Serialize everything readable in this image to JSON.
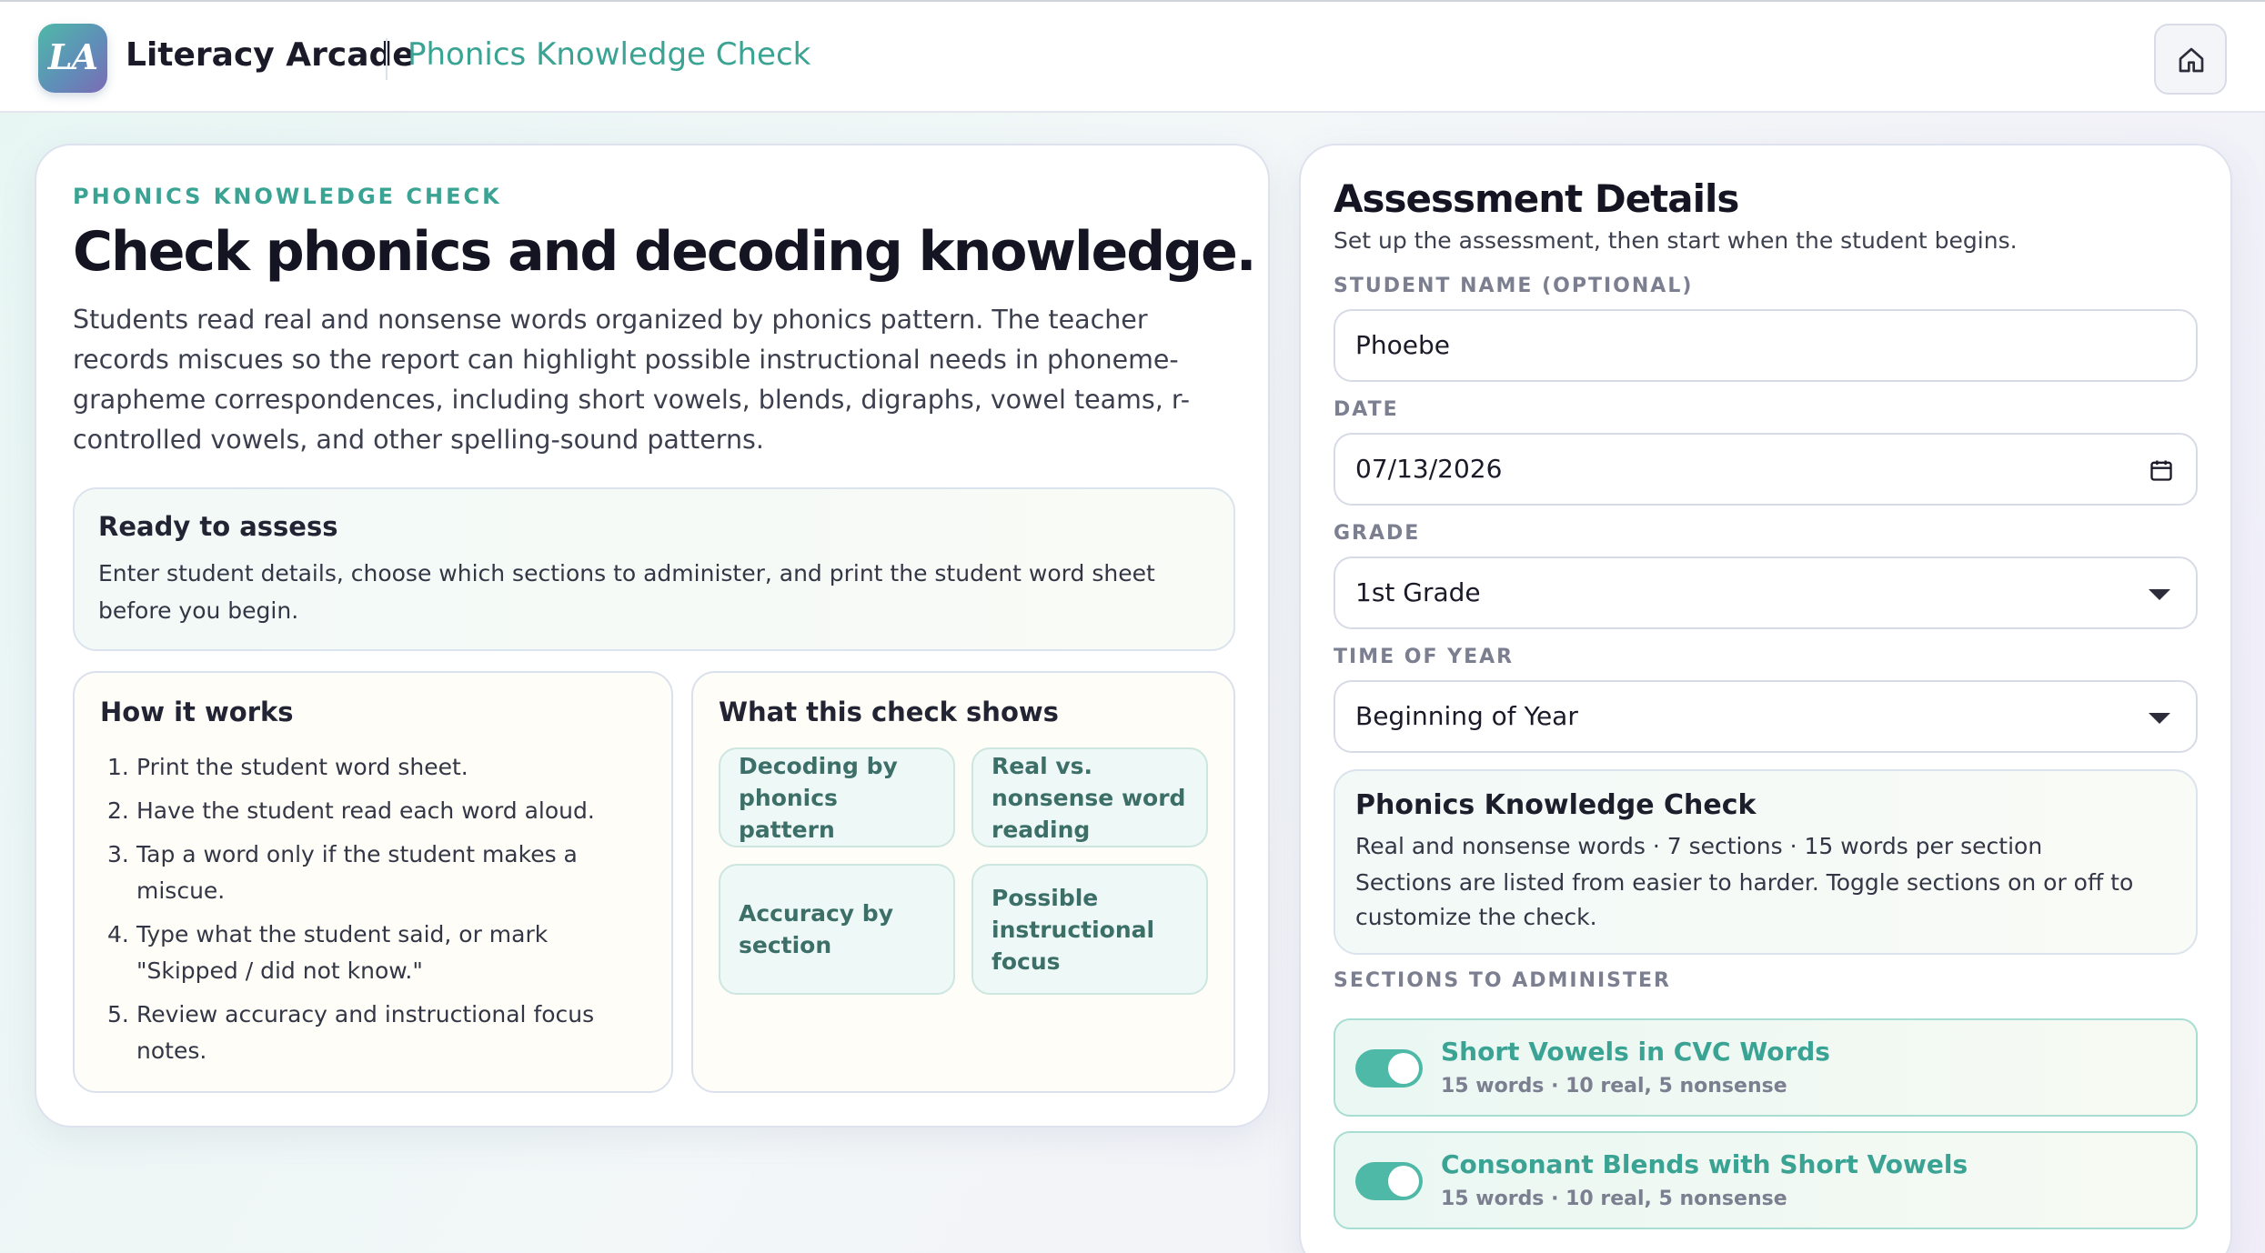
{
  "header": {
    "logo_text": "LA",
    "brand": "Literacy Arcade",
    "subtitle": "Phonics Knowledge Check"
  },
  "intro": {
    "eyebrow": "PHONICS KNOWLEDGE CHECK",
    "headline": "Check phonics and decoding knowledge.",
    "description": "Students read real and nonsense words organized by phonics pattern. The teacher records miscues so the report can highlight possible instructional needs in phoneme-grapheme correspondences, including short vowels, blends, digraphs, vowel teams, r-controlled vowels, and other spelling-sound patterns."
  },
  "ready": {
    "title": "Ready to assess",
    "text": "Enter student details, choose which sections to administer, and print the student word sheet before you begin."
  },
  "how_it_works": {
    "title": "How it works",
    "steps": [
      {
        "num": "1.",
        "text": "Print the student word sheet."
      },
      {
        "num": "2.",
        "text": "Have the student read each word aloud."
      },
      {
        "num": "3.",
        "text": "Tap a word only if the student makes a miscue."
      },
      {
        "num": "4.",
        "text": "Type what the student said, or mark \"Skipped / did not know.\""
      },
      {
        "num": "5.",
        "text": "Review accuracy and instructional focus notes."
      }
    ]
  },
  "what_it_shows": {
    "title": "What this check shows",
    "chips": [
      "Decoding by phonics pattern",
      "Real vs. nonsense word reading",
      "Accuracy by section",
      "Possible instructional focus"
    ]
  },
  "details": {
    "title": "Assessment Details",
    "subtitle": "Set up the assessment, then start when the student begins.",
    "student_label": "STUDENT NAME (OPTIONAL)",
    "student_value": "Phoebe",
    "date_label": "DATE",
    "date_value": "07/13/2026",
    "grade_label": "GRADE",
    "grade_value": "1st Grade",
    "time_label": "TIME OF YEAR",
    "time_value": "Beginning of Year",
    "info_title": "Phonics Knowledge Check",
    "info_meta": "Real and nonsense words · 7 sections · 15 words per section",
    "info_desc": "Sections are listed from easier to harder. Toggle sections on or off to customize the check.",
    "sections_label": "SECTIONS TO ADMINISTER",
    "sections": [
      {
        "name": "Short Vowels in CVC Words",
        "meta": "15 words · 10 real, 5 nonsense",
        "enabled": true
      },
      {
        "name": "Consonant Blends with Short Vowels",
        "meta": "15 words · 10 real, 5 nonsense",
        "enabled": true
      }
    ]
  },
  "colors": {
    "accent": "#3aa393",
    "toggle_on": "#4fb9a7"
  }
}
